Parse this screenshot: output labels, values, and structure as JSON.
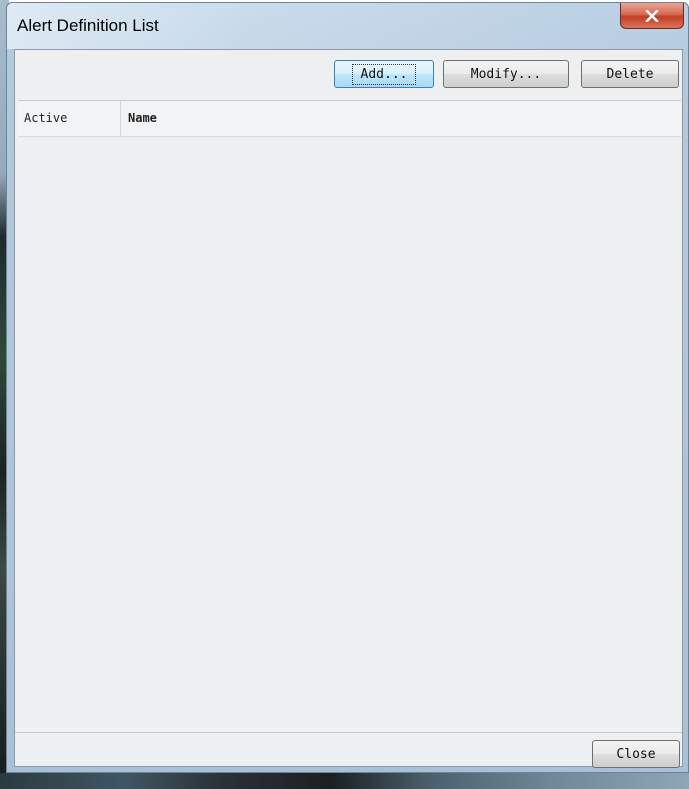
{
  "window": {
    "title": "Alert Definition List"
  },
  "toolbar": {
    "add_label": "Add...",
    "modify_label": "Modify...",
    "delete_label": "Delete"
  },
  "list": {
    "columns": [
      "Active",
      "Name"
    ],
    "rows": []
  },
  "footer": {
    "close_label": "Close"
  },
  "icons": {
    "title_close": "close-icon"
  },
  "colors": {
    "close_button": "#c94a31",
    "client_bg": "#eeeff1",
    "focus_border": "#3c7fb1"
  }
}
